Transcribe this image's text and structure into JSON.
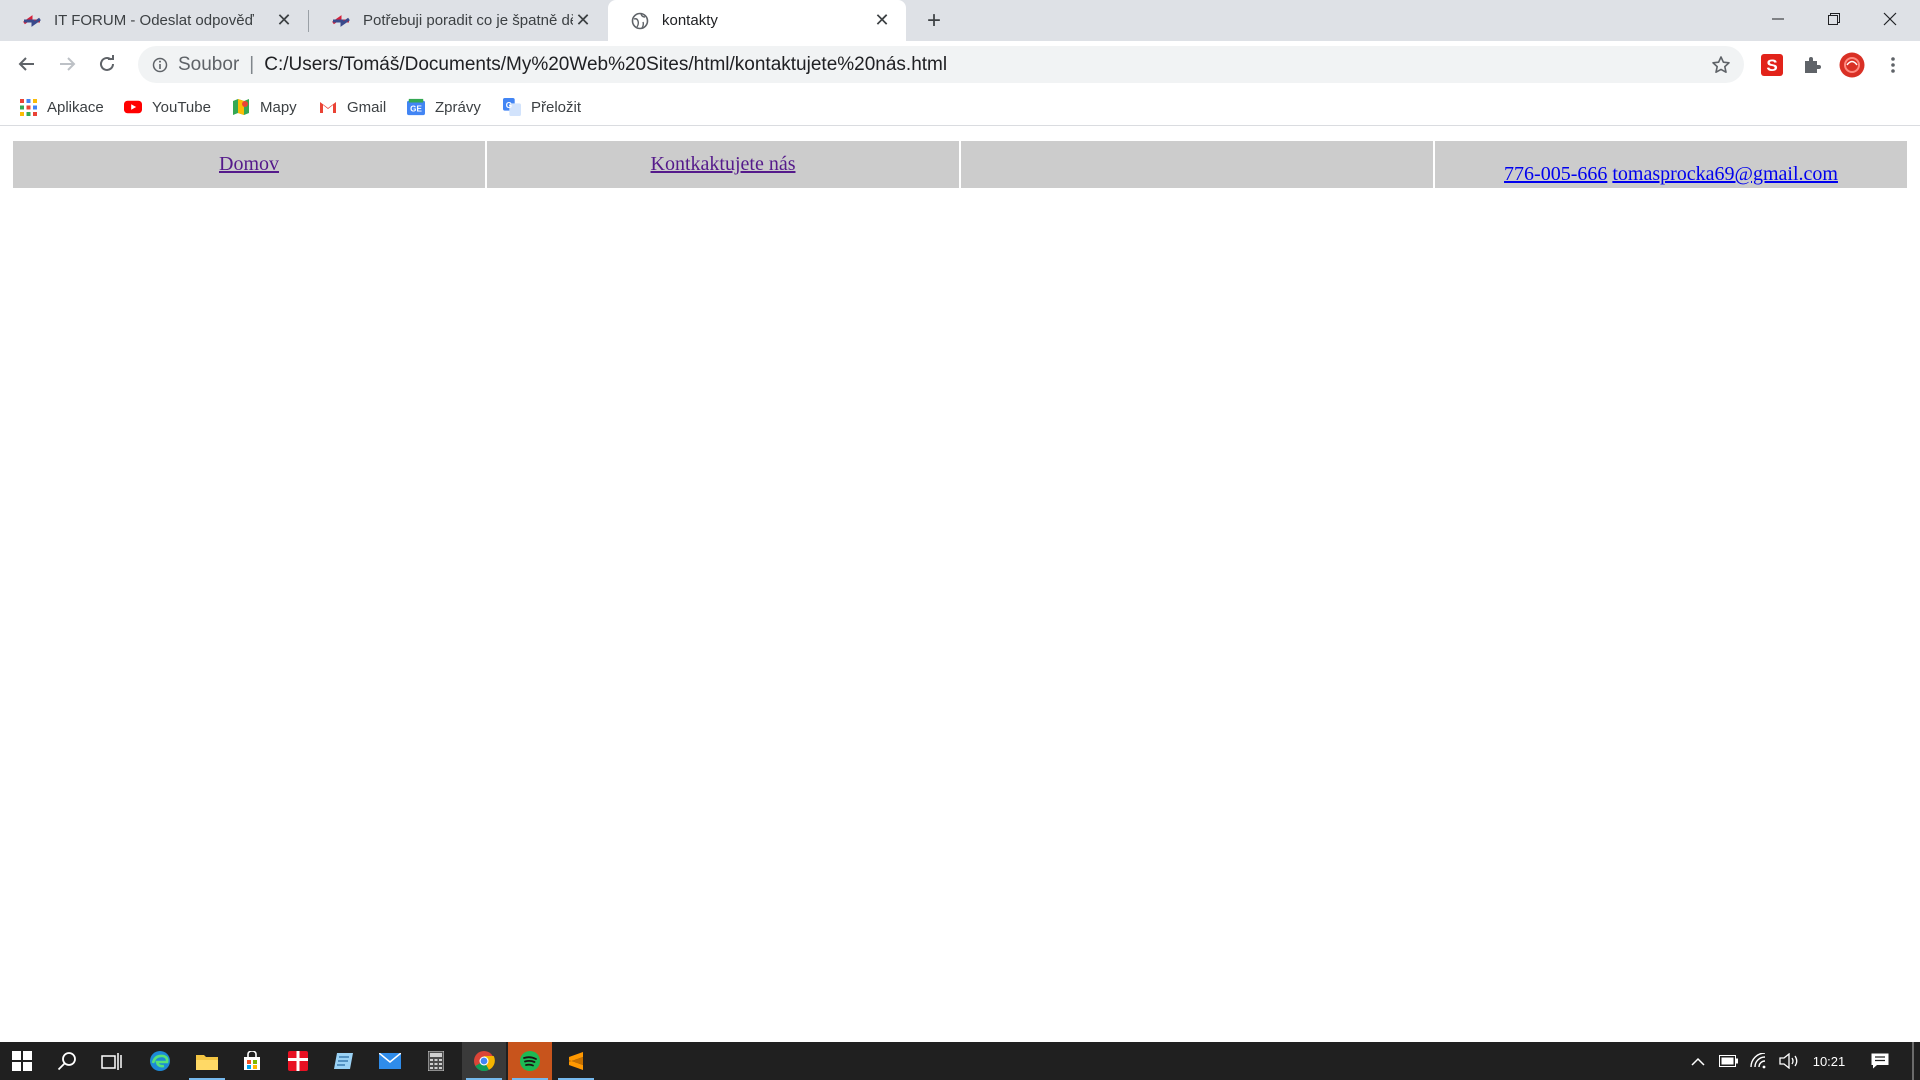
{
  "browser": {
    "tabs": [
      {
        "title": "IT FORUM - Odeslat odpověď",
        "active": false
      },
      {
        "title": "Potřebuji poradit co je špatně dě",
        "active": false
      },
      {
        "title": "kontakty",
        "active": true
      }
    ],
    "new_tab_icon": "plus-icon",
    "window_controls": [
      "minimize-icon",
      "restore-icon",
      "close-icon"
    ],
    "address_bar": {
      "scheme_label": "Soubor",
      "separator": "|",
      "url": "C:/Users/Tomáš/Documents/My%20Web%20Sites/html/kontaktujete%20nás.html"
    },
    "bookmarks": [
      {
        "label": "Aplikace",
        "icon": "apps-grid-icon"
      },
      {
        "label": "YouTube",
        "icon": "youtube-icon"
      },
      {
        "label": "Mapy",
        "icon": "maps-icon"
      },
      {
        "label": "Gmail",
        "icon": "gmail-icon"
      },
      {
        "label": "Zprávy",
        "icon": "news-icon"
      },
      {
        "label": "Přeložit",
        "icon": "translate-icon"
      }
    ]
  },
  "page": {
    "nav": {
      "home": "Domov",
      "contact": "Kontkaktujete nás",
      "empty": "",
      "phone": "776-005-666",
      "email": "tomasprocka69@gmail.com"
    }
  },
  "taskbar": {
    "clock": "10:21"
  },
  "colors": {
    "tab_strip": "#dee1e6",
    "table_cell": "#cccccc",
    "link": "#0000ee",
    "visited_link": "#551a8b",
    "taskbar": "#202020"
  }
}
